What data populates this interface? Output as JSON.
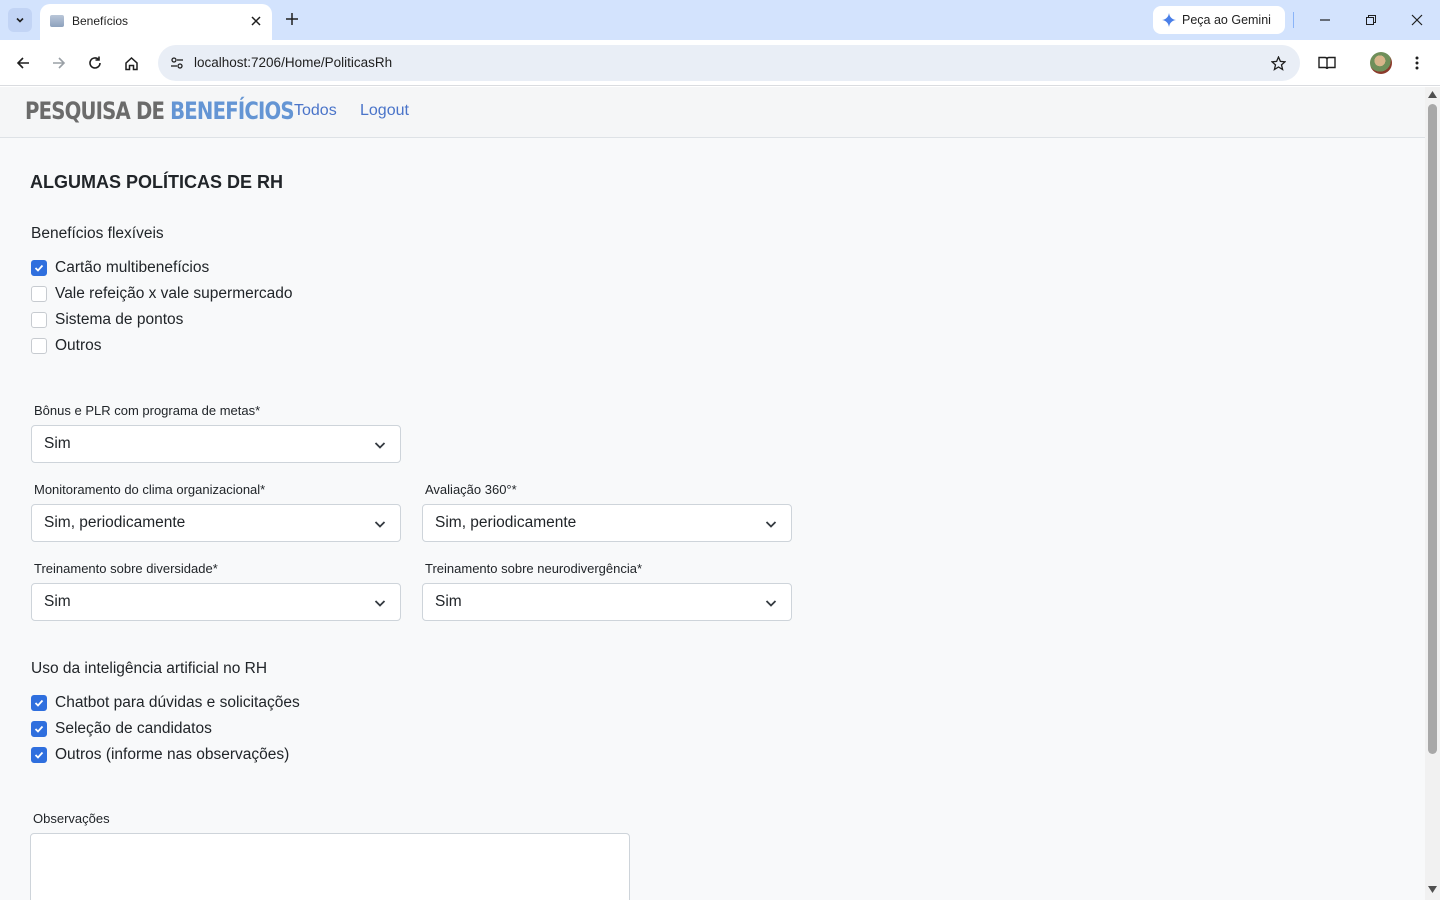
{
  "browser": {
    "tab_title": "Benefícios",
    "url": "localhost:7206/Home/PoliticasRh",
    "gemini_label": "Peça ao Gemini"
  },
  "navbar": {
    "brand_part1": "PESQUISA DE ",
    "brand_part2": "BENEFÍCIOS",
    "links": [
      "Todos",
      "Logout"
    ]
  },
  "page": {
    "heading": "ALGUMAS POLÍTICAS DE RH",
    "flex_benefits": {
      "label": "Benefícios flexíveis",
      "options": [
        {
          "label": "Cartão multibenefícios",
          "checked": true
        },
        {
          "label": "Vale refeição x vale supermercado",
          "checked": false
        },
        {
          "label": "Sistema de pontos",
          "checked": false
        },
        {
          "label": "Outros",
          "checked": false
        }
      ]
    },
    "selects": {
      "bonus": {
        "label": "Bônus e PLR com programa de metas*",
        "value": "Sim"
      },
      "clima": {
        "label": "Monitoramento do clima organizacional*",
        "value": "Sim, periodicamente"
      },
      "avaliacao": {
        "label": "Avaliação 360°*",
        "value": "Sim, periodicamente"
      },
      "diversidade": {
        "label": "Treinamento sobre diversidade*",
        "value": "Sim"
      },
      "neuro": {
        "label": "Treinamento sobre neurodivergência*",
        "value": "Sim"
      }
    },
    "ai_usage": {
      "label": "Uso da inteligência artificial no RH",
      "options": [
        {
          "label": "Chatbot para dúvidas e solicitações",
          "checked": true
        },
        {
          "label": "Seleção de candidatos",
          "checked": true
        },
        {
          "label": "Outros (informe nas observações)",
          "checked": true
        }
      ]
    },
    "observations": {
      "label": "Observações",
      "value": ""
    }
  }
}
